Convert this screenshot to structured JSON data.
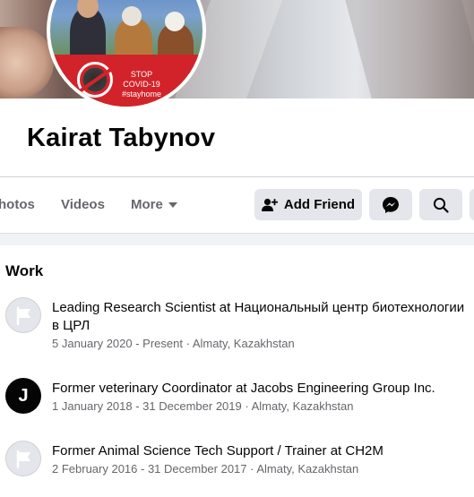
{
  "profile": {
    "name": "Kairat Tabynov",
    "avatar_badge_lines": [
      "STOP",
      "COVID-19",
      "#stayhome"
    ]
  },
  "tabs": [
    {
      "label": "hotos"
    },
    {
      "label": "Videos"
    },
    {
      "label": "More"
    }
  ],
  "actions": {
    "add_friend": "Add Friend"
  },
  "work": {
    "title": "Work",
    "items": [
      {
        "title": "Leading Research Scientist at Национальный центр биотехнологии в ЦРЛ",
        "subtitle": "5 January 2020 - Present · Almaty, Kazakhstan",
        "icon": "flag-icon"
      },
      {
        "title": "Former veterinary Coordinator at Jacobs Engineering Group Inc.",
        "subtitle": "1 January 2018 - 31 December 2019 · Almaty, Kazakhstan",
        "icon": "jacobs-logo",
        "logo_letter": "J"
      },
      {
        "title": "Former Animal Science Tech Support / Trainer at CH2M",
        "subtitle": "2 February 2016 - 31 December 2017 · Almaty, Kazakhstan",
        "icon": "flag-icon"
      }
    ]
  },
  "colors": {
    "button_bg": "#e4e6eb",
    "secondary_text": "#65676b",
    "covid_red": "#d2232a"
  }
}
